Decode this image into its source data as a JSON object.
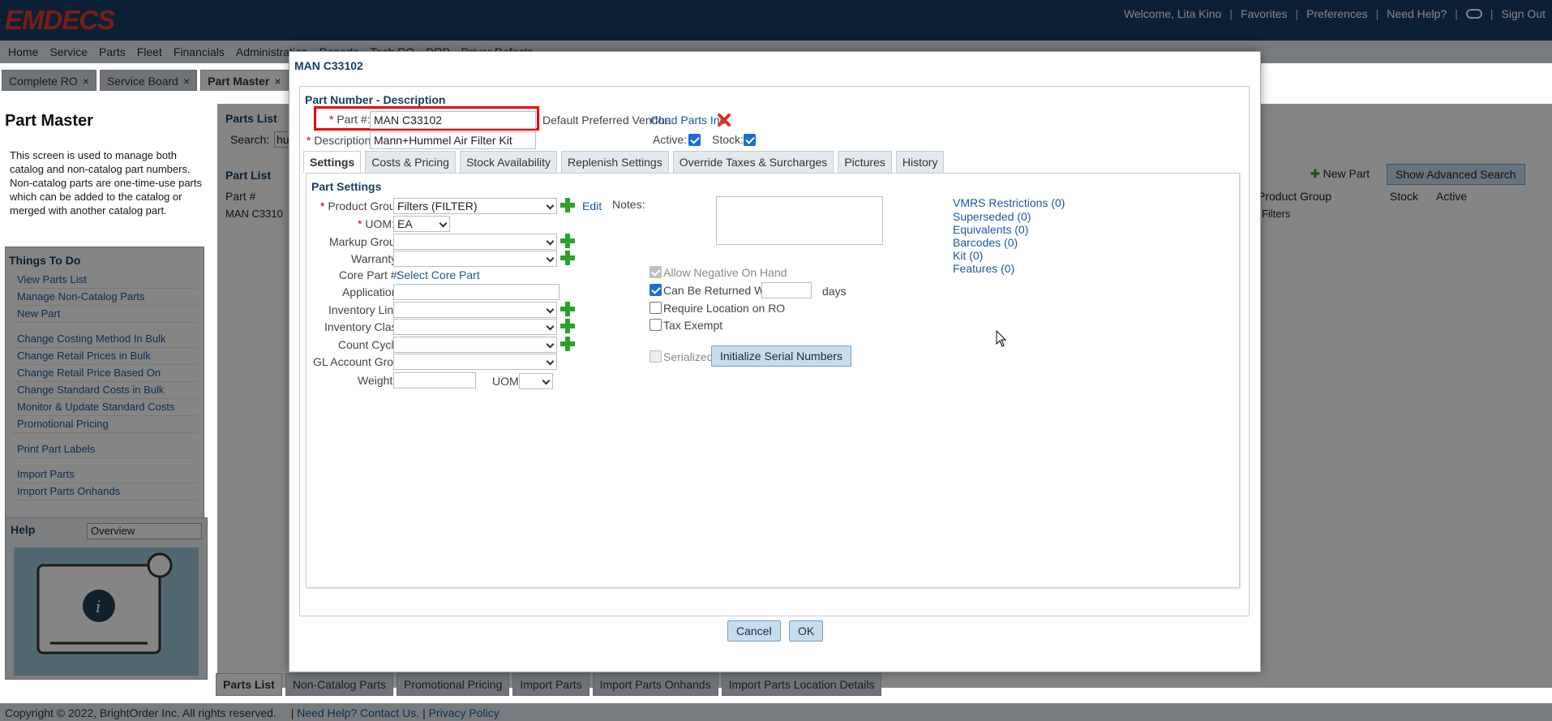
{
  "app": {
    "logo": "EMDECS"
  },
  "topbar": {
    "welcome": "Welcome, Lita Kino",
    "favorites": "Favorites",
    "preferences": "Preferences",
    "need_help": "Need Help?",
    "sign_out": "Sign Out",
    "sep": "|"
  },
  "menu": [
    "Home",
    "Service",
    "Parts",
    "Fleet",
    "Financials",
    "Administration",
    "Reports",
    "Tech RO",
    "DRP",
    "Driver Defects"
  ],
  "page_tabs": [
    {
      "label": "Complete RO"
    },
    {
      "label": "Service Board"
    },
    {
      "label": "Part Master"
    }
  ],
  "close_glyph": "×",
  "left": {
    "title": "Part Master",
    "description": "This screen is used to manage both catalog and non-catalog part numbers. Non-catalog parts are one-time-use parts which can be added to the catalog or merged with another catalog part.",
    "todo_title": "Things To Do",
    "todo": [
      "View Parts List",
      "Manage Non-Catalog Parts",
      "New Part",
      "Change Costing Method In Bulk",
      "Change Retail Prices in Bulk",
      "Change Retail Price Based On",
      "Change Standard Costs in Bulk",
      "Monitor & Update Standard Costs",
      "Promotional Pricing",
      "Print Part Labels",
      "Import Parts",
      "Import Parts Onhands"
    ],
    "help_title": "Help",
    "help_select": "Overview"
  },
  "background": {
    "parts_list": "Parts List",
    "search_label": "Search:",
    "search_value": "hu",
    "part_list2": "Part List",
    "col_part": "Part #",
    "row_part": "MAN C3310",
    "new_part": "New Part",
    "show_adv": "Show Advanced Search",
    "col_product_group": "Product Group",
    "col_stock": "Stock",
    "col_active": "Active",
    "row_group": "Filters"
  },
  "bottom_tabs": [
    "Parts List",
    "Non-Catalog Parts",
    "Promotional Pricing",
    "Import Parts",
    "Import Parts Onhands",
    "Import Parts Location Details"
  ],
  "footer": {
    "copyright": "Copyright © 2022, BrightOrder Inc. All rights reserved.",
    "need_help": "Need Help? Contact Us.",
    "privacy": "Privacy Policy",
    "sep": "|"
  },
  "dialog": {
    "title": "MAN C33102",
    "section_title": "Part Number - Description",
    "part_label": "Part #:",
    "part_value": "MAN C33102",
    "desc_label": "Description:",
    "desc_value": "Mann+Hummel Air Filter Kit",
    "vendor_label": "Default Preferred Vendor:",
    "vendor_value": "Chad Parts Inc.",
    "active_label": "Active:",
    "stock_label": "Stock:",
    "active": true,
    "stock": true,
    "tabs": [
      "Settings",
      "Costs & Pricing",
      "Stock Availability",
      "Replenish Settings",
      "Override Taxes & Surcharges",
      "Pictures",
      "History"
    ],
    "settings": {
      "title": "Part Settings",
      "product_group_label": "Product Group:",
      "product_group_value": "Filters (FILTER)",
      "edit": "Edit",
      "uom_label": "UOM:",
      "uom_value": "EA",
      "markup_label": "Markup Group:",
      "warranty_label": "Warranty:",
      "core_label": "Core Part #:",
      "core_link": "Select Core Part",
      "application_label": "Application:",
      "inv_line_label": "Inventory Line:",
      "inv_class_label": "Inventory Class:",
      "count_cycle_label": "Count Cycle:",
      "gl_label": "GL Account Group:",
      "weight_label": "Weight:",
      "weight_uom_label": "UOM:",
      "notes_label": "Notes:",
      "allow_negative": "Allow Negative On Hand",
      "allow_negative_checked": true,
      "can_return": "Can Be Returned Within",
      "can_return_checked": true,
      "days": "days",
      "require_location": "Require Location on RO",
      "require_location_checked": false,
      "tax_exempt": "Tax Exempt",
      "tax_exempt_checked": false,
      "serialized": "Serialized",
      "serialized_checked": false,
      "init_serial": "Initialize Serial Numbers",
      "right_links": [
        "VMRS Restrictions (0)",
        "Superseded (0)",
        "Equivalents (0)",
        "Barcodes (0)",
        "Kit (0)",
        "Features (0)"
      ]
    },
    "cancel": "Cancel",
    "ok": "OK"
  }
}
